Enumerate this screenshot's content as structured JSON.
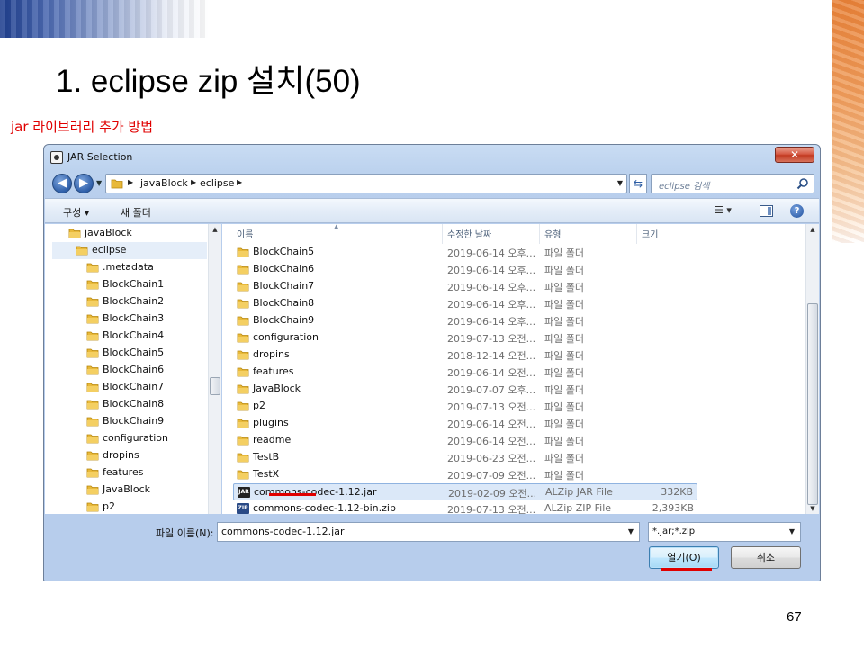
{
  "slide": {
    "title": "1. eclipse zip 설치(50)",
    "subtitle": "jar 라이브러리 추가 방법",
    "page_number": "67"
  },
  "dialog": {
    "title": "JAR Selection",
    "close_symbol": "✕",
    "breadcrumbs": [
      "javaBlock",
      "eclipse"
    ],
    "search_placeholder": "eclipse 검색",
    "toolbar": {
      "organize": "구성 ▾",
      "new_folder": "새 폴더"
    },
    "nav_tree": [
      {
        "label": "javaBlock",
        "level": 0
      },
      {
        "label": "eclipse",
        "level": 1,
        "selected": true
      },
      {
        "label": ".metadata",
        "level": 2
      },
      {
        "label": "BlockChain1",
        "level": 2
      },
      {
        "label": "BlockChain2",
        "level": 2
      },
      {
        "label": "BlockChain3",
        "level": 2
      },
      {
        "label": "BlockChain4",
        "level": 2
      },
      {
        "label": "BlockChain5",
        "level": 2
      },
      {
        "label": "BlockChain6",
        "level": 2
      },
      {
        "label": "BlockChain7",
        "level": 2
      },
      {
        "label": "BlockChain8",
        "level": 2
      },
      {
        "label": "BlockChain9",
        "level": 2
      },
      {
        "label": "configuration",
        "level": 2
      },
      {
        "label": "dropins",
        "level": 2
      },
      {
        "label": "features",
        "level": 2
      },
      {
        "label": "JavaBlock",
        "level": 2
      },
      {
        "label": "p2",
        "level": 2
      }
    ],
    "columns": {
      "name": "이름",
      "date": "수정한 날짜",
      "type": "유형",
      "size": "크기"
    },
    "files": [
      {
        "name": "BlockChain5",
        "date": "2019-06-14 오후...",
        "type": "파일 폴더",
        "size": "",
        "kind": "folder"
      },
      {
        "name": "BlockChain6",
        "date": "2019-06-14 오후...",
        "type": "파일 폴더",
        "size": "",
        "kind": "folder"
      },
      {
        "name": "BlockChain7",
        "date": "2019-06-14 오후...",
        "type": "파일 폴더",
        "size": "",
        "kind": "folder"
      },
      {
        "name": "BlockChain8",
        "date": "2019-06-14 오후...",
        "type": "파일 폴더",
        "size": "",
        "kind": "folder"
      },
      {
        "name": "BlockChain9",
        "date": "2019-06-14 오후...",
        "type": "파일 폴더",
        "size": "",
        "kind": "folder"
      },
      {
        "name": "configuration",
        "date": "2019-07-13 오전...",
        "type": "파일 폴더",
        "size": "",
        "kind": "folder"
      },
      {
        "name": "dropins",
        "date": "2018-12-14 오전...",
        "type": "파일 폴더",
        "size": "",
        "kind": "folder"
      },
      {
        "name": "features",
        "date": "2019-06-14 오전...",
        "type": "파일 폴더",
        "size": "",
        "kind": "folder"
      },
      {
        "name": "JavaBlock",
        "date": "2019-07-07 오후...",
        "type": "파일 폴더",
        "size": "",
        "kind": "folder"
      },
      {
        "name": "p2",
        "date": "2019-07-13 오전...",
        "type": "파일 폴더",
        "size": "",
        "kind": "folder"
      },
      {
        "name": "plugins",
        "date": "2019-06-14 오전...",
        "type": "파일 폴더",
        "size": "",
        "kind": "folder"
      },
      {
        "name": "readme",
        "date": "2019-06-14 오전...",
        "type": "파일 폴더",
        "size": "",
        "kind": "folder"
      },
      {
        "name": "TestB",
        "date": "2019-06-23 오전...",
        "type": "파일 폴더",
        "size": "",
        "kind": "folder"
      },
      {
        "name": "TestX",
        "date": "2019-07-09 오전...",
        "type": "파일 폴더",
        "size": "",
        "kind": "folder"
      },
      {
        "name": "commons-codec-1.12.jar",
        "date": "2019-02-09 오전...",
        "type": "ALZip JAR File",
        "size": "332KB",
        "kind": "jar",
        "selected": true
      },
      {
        "name": "commons-codec-1.12-bin.zip",
        "date": "2019-07-13 오전...",
        "type": "ALZip ZIP File",
        "size": "2,393KB",
        "kind": "zip"
      }
    ],
    "filename_label": "파일 이름(N):",
    "filename_value": "commons-codec-1.12.jar",
    "filter_value": "*.jar;*.zip",
    "open_button": "열기(O)",
    "cancel_button": "취소"
  },
  "colors": {
    "subtitle_red": "#e00000",
    "selection_bg": "#dbe8f8",
    "window_frame": "#b7cdec",
    "annotation_red": "#e00000"
  }
}
